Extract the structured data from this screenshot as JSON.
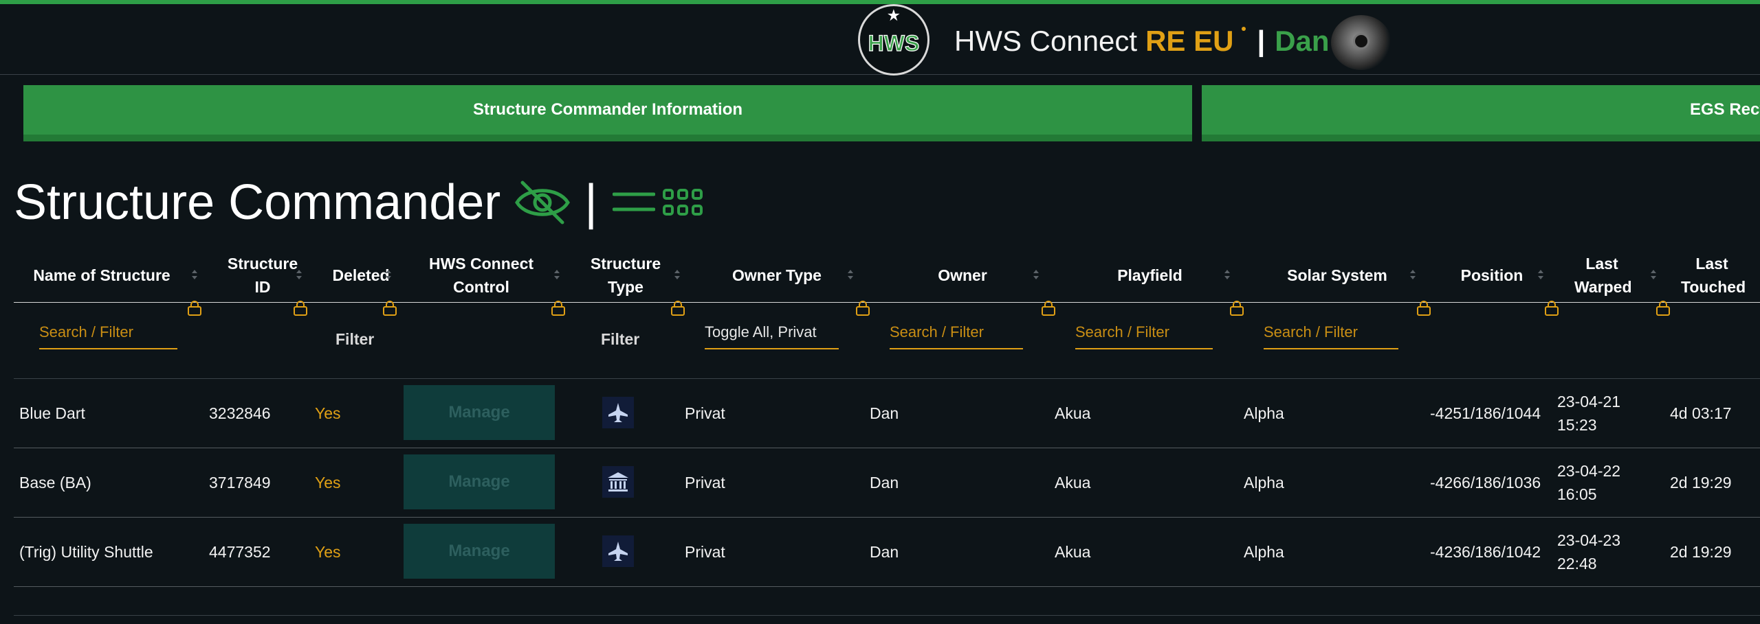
{
  "header": {
    "logo_text": "HWS",
    "app_name": "HWS Connect",
    "region": "RE EU",
    "separator": "|",
    "user": "Dan"
  },
  "tabs": [
    {
      "label": "Structure Commander Information"
    },
    {
      "label": "EGS Recy"
    }
  ],
  "page": {
    "title": "Structure Commander",
    "title_separator": "|"
  },
  "colors": {
    "accent_green": "#2e9344",
    "accent_orange": "#e0a015",
    "background": "#0d1418"
  },
  "table": {
    "columns": [
      {
        "label": "Name of Structure"
      },
      {
        "label": "Structure ID"
      },
      {
        "label": "Deleted"
      },
      {
        "label": "HWS Connect Control"
      },
      {
        "label": "Structure Type"
      },
      {
        "label": "Owner Type"
      },
      {
        "label": "Owner"
      },
      {
        "label": "Playfield"
      },
      {
        "label": "Solar System"
      },
      {
        "label": "Position"
      },
      {
        "label": "Last Warped"
      },
      {
        "label": "Last Touched"
      }
    ],
    "filters": {
      "name_placeholder": "Search / Filter",
      "deleted_label": "Filter",
      "type_label": "Filter",
      "owner_type_value": "Toggle All, Privat",
      "owner_placeholder": "Search / Filter",
      "playfield_placeholder": "Search / Filter",
      "solar_placeholder": "Search / Filter"
    },
    "manage_label": "Manage",
    "rows": [
      {
        "name": "Blue Dart",
        "id": "3232846",
        "deleted": "Yes",
        "type_icon": "ship-icon",
        "owner_type": "Privat",
        "owner": "Dan",
        "playfield": "Akua",
        "solar": "Alpha",
        "position": "-4251/186/1044",
        "warped_date": "23-04-21",
        "warped_time": "15:23",
        "touched": "4d 03:17"
      },
      {
        "name": "Base (BA)",
        "id": "3717849",
        "deleted": "Yes",
        "type_icon": "base-icon",
        "owner_type": "Privat",
        "owner": "Dan",
        "playfield": "Akua",
        "solar": "Alpha",
        "position": "-4266/186/1036",
        "warped_date": "23-04-22",
        "warped_time": "16:05",
        "touched": "2d 19:29"
      },
      {
        "name": "(Trig) Utility Shuttle",
        "id": "4477352",
        "deleted": "Yes",
        "type_icon": "ship-icon",
        "owner_type": "Privat",
        "owner": "Dan",
        "playfield": "Akua",
        "solar": "Alpha",
        "position": "-4236/186/1042",
        "warped_date": "23-04-23",
        "warped_time": "22:48",
        "touched": "2d 19:29"
      }
    ]
  }
}
